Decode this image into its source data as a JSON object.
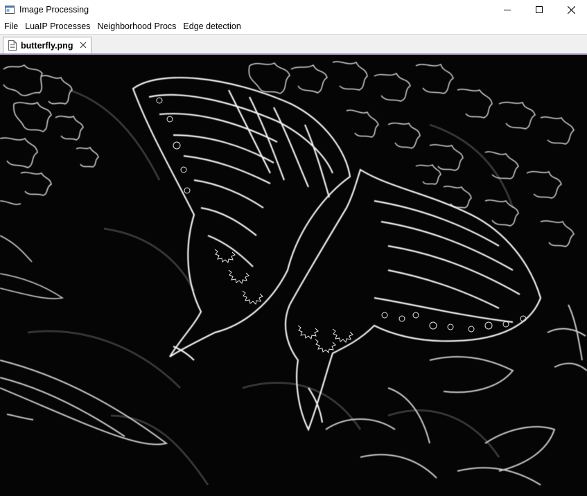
{
  "window": {
    "title": "Image Processing",
    "icon": "app-window-icon",
    "controls": [
      "minimize-icon",
      "maximize-icon",
      "close-icon"
    ]
  },
  "menu": {
    "items": [
      {
        "label": "File"
      },
      {
        "label": "LuaIP Processes"
      },
      {
        "label": "Neighborhood Procs"
      },
      {
        "label": "Edge detection"
      }
    ]
  },
  "tabs": [
    {
      "label": "butterfly.png",
      "icon": "document-icon",
      "active": true
    }
  ],
  "image": {
    "description_icon": "edge-detected-butterfly-image",
    "background_color": "#050505",
    "edge_color": "#e8e8e8"
  }
}
